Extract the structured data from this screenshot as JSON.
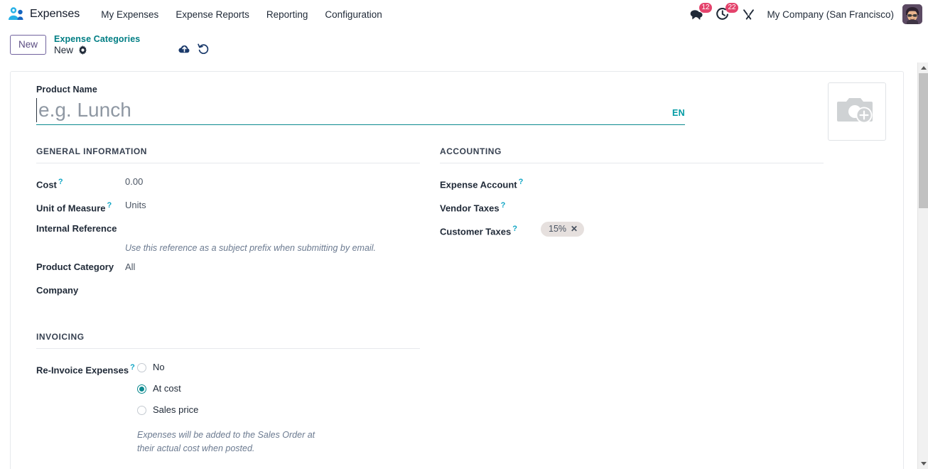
{
  "navbar": {
    "app_icon": "expenses-people-icon",
    "app_name": "Expenses",
    "menu": [
      {
        "label": "My Expenses"
      },
      {
        "label": "Expense Reports"
      },
      {
        "label": "Reporting"
      },
      {
        "label": "Configuration"
      }
    ],
    "systray": {
      "messages_icon": "chat-bubble-icon",
      "messages_count": "12",
      "activities_icon": "clock-activity-icon",
      "activities_count": "22",
      "debug_icon": "wrench-tools-icon",
      "company": "My Company (San Francisco)",
      "avatar_icon": "user-avatar"
    }
  },
  "control_panel": {
    "new_button": "New",
    "breadcrumb_parent": "Expense Categories",
    "breadcrumb_current": "New",
    "settings_icon": "gear-icon",
    "save_icon": "cloud-upload-icon",
    "discard_icon": "undo-arrow-icon"
  },
  "form": {
    "image_placeholder_icon": "camera-plus-icon",
    "title": {
      "label": "Product Name",
      "value": "",
      "placeholder": "e.g. Lunch",
      "language": "EN"
    },
    "general_information": {
      "title": "GENERAL INFORMATION",
      "fields": [
        {
          "label": "Cost",
          "help": "?",
          "value": "0.00"
        },
        {
          "label": "Unit of Measure",
          "help": "?",
          "value": "Units"
        },
        {
          "label": "Internal Reference",
          "help": "",
          "value": ""
        },
        {
          "label": "Product Category",
          "help": "",
          "value": "All"
        },
        {
          "label": "Company",
          "help": "",
          "value": ""
        }
      ],
      "internal_reference_hint": "Use this reference as a subject prefix when submitting by email."
    },
    "accounting": {
      "title": "ACCOUNTING",
      "fields": [
        {
          "label": "Expense Account",
          "help": "?",
          "value": ""
        },
        {
          "label": "Vendor Taxes",
          "help": "?",
          "value": ""
        },
        {
          "label": "Customer Taxes",
          "help": "?",
          "value": ""
        }
      ],
      "customer_taxes_tag": "15%",
      "tag_remove_icon": "close-x-icon"
    },
    "invoicing": {
      "title": "INVOICING",
      "field_label": "Re-Invoice Expenses",
      "help": "?",
      "options": [
        {
          "label": "No",
          "selected": false
        },
        {
          "label": "At cost",
          "selected": true
        },
        {
          "label": "Sales price",
          "selected": false
        }
      ],
      "hint": "Expenses will be added to the Sales Order at their actual cost when posted."
    }
  },
  "colors": {
    "brand_teal": "#017e84",
    "accent_purple": "#71639e",
    "badge_red": "#e4436c",
    "help_blue": "#0ea5c4",
    "tag_bg": "#e6e0de"
  }
}
